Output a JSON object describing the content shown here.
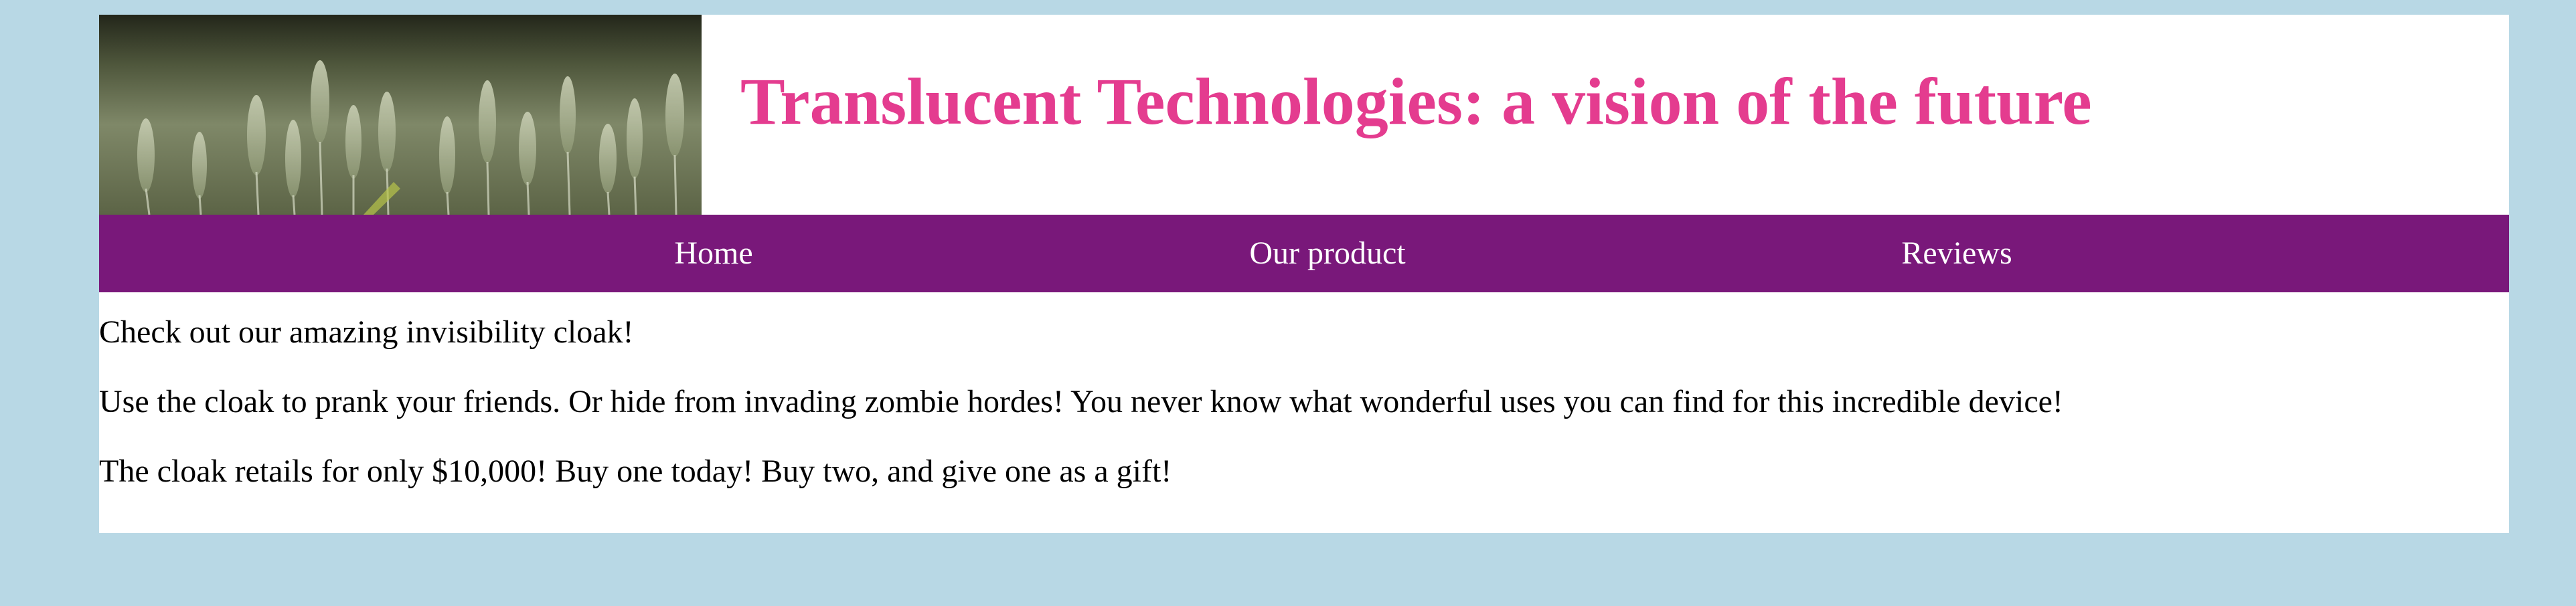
{
  "header": {
    "banner_image": "wheat-field-photo",
    "title": "Translucent Technologies: a vision of the future"
  },
  "nav": {
    "items": [
      {
        "label": "Home"
      },
      {
        "label": "Our product"
      },
      {
        "label": "Reviews"
      }
    ]
  },
  "content": {
    "paragraphs": [
      "Check out our amazing invisibility cloak!",
      "Use the cloak to prank your friends. Or hide from invading zombie hordes! You never know what wonderful uses you can find for this incredible device!",
      "The cloak retails for only $10,000! Buy one today! Buy two, and give one as a gift!"
    ]
  },
  "colors": {
    "background": "#b8d8e5",
    "nav_background": "#79187a",
    "title_color": "#e43c8f",
    "nav_text": "#ffffff"
  }
}
